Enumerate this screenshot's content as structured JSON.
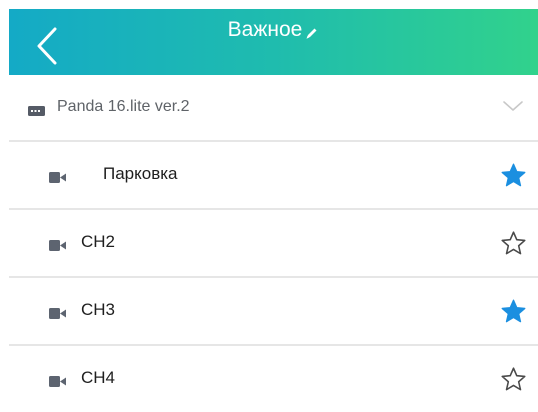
{
  "header": {
    "title": "Важное",
    "back_icon": "chevron-left-icon",
    "edit_icon": "pencil-icon",
    "gradient_start": "#14aac6",
    "gradient_end": "#31d28c"
  },
  "device": {
    "name": "Panda 16.lite ver.2",
    "icon": "dvr-icon",
    "expand_icon": "chevron-down-icon"
  },
  "channels": [
    {
      "name": "Парковка",
      "favorite": true
    },
    {
      "name": "CH2",
      "favorite": false
    },
    {
      "name": "CH3",
      "favorite": true
    },
    {
      "name": "CH4",
      "favorite": false
    }
  ],
  "colors": {
    "favorite_star": "#1b8fe0",
    "outline_star": "#4a4a4a",
    "divider": "#e6e6e6"
  }
}
